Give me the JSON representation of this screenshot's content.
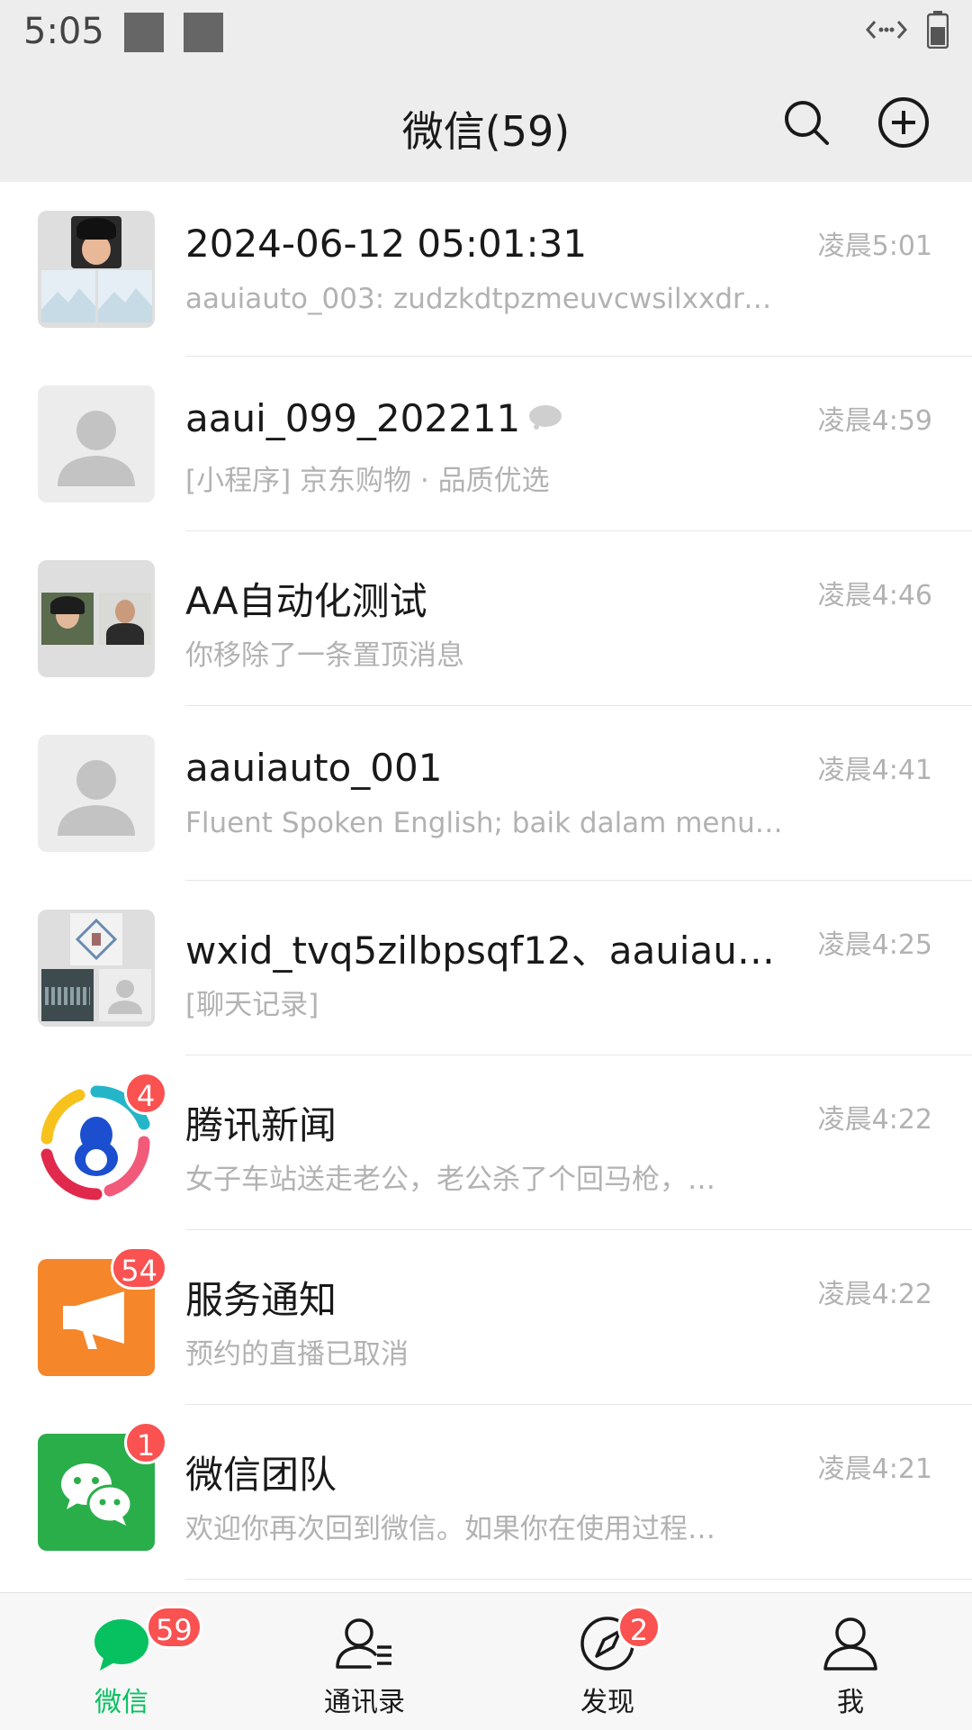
{
  "status": {
    "time": "5:05"
  },
  "header": {
    "title": "微信(59)"
  },
  "chats": [
    {
      "title": "2024-06-12 05:01:31",
      "subtitle": "aauiauto_003: zudzkdtpzmeuvcwsilxxdrhl…",
      "time": "凌晨5:01"
    },
    {
      "title": "aaui_099_202211",
      "subtitle": "[小程序] 京东购物 · 品质优选",
      "time": "凌晨4:59"
    },
    {
      "title": "AA自动化测试",
      "subtitle": "你移除了一条置顶消息",
      "time": "凌晨4:46"
    },
    {
      "title": "aauiauto_001",
      "subtitle": "Fluent Spoken English; baik dalam menul…",
      "time": "凌晨4:41"
    },
    {
      "title": "wxid_tvq5zilbpsqf12、aauiaut…",
      "subtitle": "[聊天记录]",
      "time": "凌晨4:25"
    },
    {
      "title": "腾讯新闻",
      "subtitle": "女子车站送走老公，老公杀了个回马枪，…",
      "time": "凌晨4:22",
      "badge": "4"
    },
    {
      "title": "服务通知",
      "subtitle": "预约的直播已取消",
      "time": "凌晨4:22",
      "badge": "54"
    },
    {
      "title": "微信团队",
      "subtitle": "欢迎你再次回到微信。如果你在使用过程…",
      "time": "凌晨4:21",
      "badge": "1"
    }
  ],
  "tabs": [
    {
      "label": "微信",
      "badge": "59",
      "active": true
    },
    {
      "label": "通讯录"
    },
    {
      "label": "发现",
      "badge": "2"
    },
    {
      "label": "我"
    }
  ],
  "colors": {
    "accent": "#07c160",
    "badge": "#fa5151",
    "header_bg": "#ededed"
  },
  "icons": [
    "search-icon",
    "add-icon",
    "mute-icon",
    "chat-icon",
    "contacts-icon",
    "discover-icon",
    "me-icon"
  ]
}
